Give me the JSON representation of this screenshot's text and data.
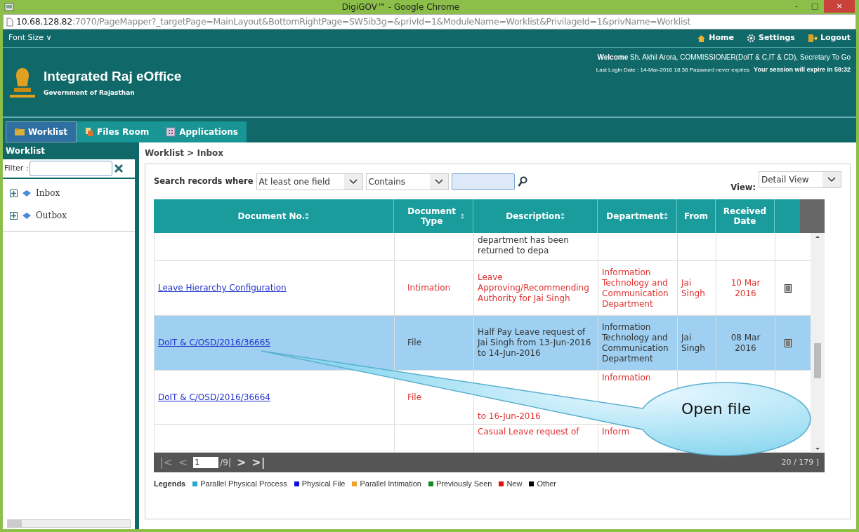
{
  "window": {
    "title": "DigiGOV™ - Google Chrome",
    "controls": [
      "-",
      "□",
      "×"
    ]
  },
  "address_bar": {
    "host": "10.68.128.82",
    "rest": ":7070/PageMapper?_targetPage=MainLayout&BottomRightPage=SW5ib3g=&privId=1&ModuleName=Worklist&PrivilageId=1&privName=Worklist"
  },
  "top_nav": {
    "font_size": "Font Size",
    "font_size_caret": "∨",
    "links": [
      {
        "kind": "home",
        "label": "Home"
      },
      {
        "kind": "settings",
        "label": "Settings"
      },
      {
        "kind": "logout",
        "label": "Logout"
      }
    ]
  },
  "header": {
    "title": "Integrated Raj eOffice",
    "subtitle": "Government of Rajasthan",
    "welcome_label": "Welcome",
    "welcome_text": "Sh. Akhil Arora, COMMISSIONER(DoIT & C,IT & CD), Secretary To Go",
    "last_login": "Last Login Date : 14-Mar-2016 18:38  Password never expires",
    "session": "Your session will expire in 59:32"
  },
  "tabs": [
    {
      "label": "Worklist",
      "kind": "worklist",
      "selected": true
    },
    {
      "label": "Files Room",
      "kind": "files",
      "selected": false
    },
    {
      "label": "Applications",
      "kind": "apps",
      "selected": false
    }
  ],
  "sidebar": {
    "title": "Worklist",
    "filter_label": "Filter :",
    "items": [
      {
        "label": "Inbox",
        "expanded": false
      },
      {
        "label": "Outbox",
        "expanded": false
      }
    ]
  },
  "breadcrumb": "Worklist > Inbox",
  "search": {
    "label": "Search records where",
    "field": "At least one field",
    "operator": "Contains",
    "view_label": "View:",
    "view": "Detail View"
  },
  "table": {
    "columns": [
      "Document No.",
      "Document Type",
      "Description",
      "Department",
      "From",
      "Received Date"
    ],
    "rows": [
      {
        "kind": "partial",
        "description": "department has been returned to depa",
        "selected": false,
        "new": false
      },
      {
        "kind": "full",
        "doc_no": "Leave Hierarchy Configuration",
        "type": "Intimation",
        "description": "Leave Approving/Recommending Authority for Jai Singh",
        "department": "Information Technology and Communication Department",
        "from": "Jai Singh",
        "date": "10 Mar 2016",
        "selected": false,
        "new": true
      },
      {
        "kind": "full",
        "doc_no": "DoIT & C/OSD/2016/36665",
        "type": "File",
        "description": "Half Pay Leave request of Jai Singh from 13-Jun-2016 to 14-Jun-2016",
        "department": "Information Technology and Communication Department",
        "from": "Jai Singh",
        "date": "08 Mar 2016",
        "selected": true,
        "new": false
      },
      {
        "kind": "covered",
        "doc_no": "DoIT & C/OSD/2016/36664",
        "type": "File",
        "description": "to 16-Jun-2016",
        "department": "Information",
        "selected": false,
        "new": true
      },
      {
        "kind": "partial",
        "description": "Casual Leave request of",
        "department": "Inform",
        "selected": false,
        "new": true
      }
    ]
  },
  "pager": {
    "first": "|<",
    "prev": "<",
    "page": "1",
    "total": "/9|",
    "next": ">",
    "last": ">|",
    "count": "20 / 179 ]"
  },
  "legends": {
    "title": "Legends",
    "items": [
      {
        "label": "Parallel Physical Process",
        "color": "#2aa6d6"
      },
      {
        "label": "Physical File",
        "color": "#1010e0"
      },
      {
        "label": "Parallel Intimation",
        "color": "#f0a030"
      },
      {
        "label": "Previously Seen",
        "color": "#108a20"
      },
      {
        "label": "New",
        "color": "#e01010"
      },
      {
        "label": "Other",
        "color": "#000000"
      }
    ]
  },
  "callout": {
    "text": "Open file"
  }
}
